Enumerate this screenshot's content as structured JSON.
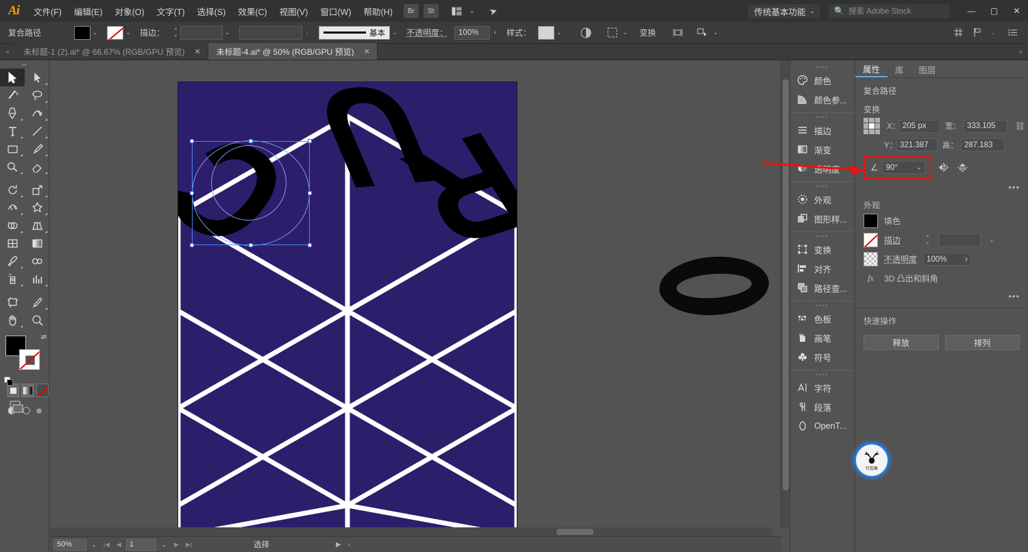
{
  "app": {
    "name": "Adobe Illustrator",
    "logo_text": "Ai"
  },
  "menubar": {
    "items": [
      {
        "label": "文件(F)",
        "name": "menu-file"
      },
      {
        "label": "编辑(E)",
        "name": "menu-edit"
      },
      {
        "label": "对象(O)",
        "name": "menu-object"
      },
      {
        "label": "文字(T)",
        "name": "menu-type"
      },
      {
        "label": "选择(S)",
        "name": "menu-select"
      },
      {
        "label": "效果(C)",
        "name": "menu-effect"
      },
      {
        "label": "视图(V)",
        "name": "menu-view"
      },
      {
        "label": "窗口(W)",
        "name": "menu-window"
      },
      {
        "label": "帮助(H)",
        "name": "menu-help"
      }
    ],
    "bridge_button": "Br",
    "stock_button": "St",
    "arrange_caret": "⌄",
    "workspace": "传统基本功能",
    "workspace_caret": "⌄",
    "search_placeholder": "搜索 Adobe Stock",
    "window_minimize": "—",
    "window_maximize": "▢",
    "window_close": "✕"
  },
  "controlbar": {
    "object_label": "复合路径",
    "fill_swatch_color": "#000000",
    "stroke_swatch": "none",
    "stroke_label": "描边：",
    "stroke_weight_value": "",
    "stroke_profile_value": "",
    "brush_label": "基本",
    "opacity_label": "不透明度：",
    "opacity_value": "100%",
    "style_label": "样式：",
    "transparency_icon": "transparency-icon",
    "select_similar_icon": "select-similar-icon",
    "transform_label": "变换",
    "align_icon": "align-icon",
    "arrange_icon": "arrange-icon",
    "right_icons": [
      "grid-icon",
      "flow-icon",
      "list-icon"
    ]
  },
  "tabs": [
    {
      "title": "未标题-1 (2).ai* @ 66.67% (RGB/GPU 预览)",
      "active": false,
      "close": "✕"
    },
    {
      "title": "未标题-4.ai* @ 50% (RGB/GPU 预览)",
      "active": true,
      "close": "✕"
    }
  ],
  "toolbar": {
    "tools": [
      {
        "name": "selection-tool",
        "selected": true
      },
      {
        "name": "direct-selection-tool",
        "selected": false
      },
      {
        "name": "magic-wand-tool",
        "selected": false
      },
      {
        "name": "lasso-tool",
        "selected": false
      },
      {
        "name": "pen-tool",
        "selected": false
      },
      {
        "name": "curvature-tool",
        "selected": false
      },
      {
        "name": "type-tool",
        "selected": false
      },
      {
        "name": "line-segment-tool",
        "selected": false
      },
      {
        "name": "rectangle-tool",
        "selected": false
      },
      {
        "name": "paintbrush-tool",
        "selected": false
      },
      {
        "name": "shaper-tool",
        "selected": false
      },
      {
        "name": "eraser-tool",
        "selected": false
      },
      {
        "name": "rotate-tool",
        "selected": false
      },
      {
        "name": "scale-tool",
        "selected": false
      },
      {
        "name": "width-tool",
        "selected": false
      },
      {
        "name": "free-transform-tool",
        "selected": false
      },
      {
        "name": "shape-builder-tool",
        "selected": false
      },
      {
        "name": "perspective-grid-tool",
        "selected": false
      },
      {
        "name": "mesh-tool",
        "selected": false
      },
      {
        "name": "gradient-tool",
        "selected": false
      },
      {
        "name": "eyedropper-tool",
        "selected": false
      },
      {
        "name": "blend-tool",
        "selected": false
      },
      {
        "name": "symbol-sprayer-tool",
        "selected": false
      },
      {
        "name": "column-graph-tool",
        "selected": false
      },
      {
        "name": "artboard-tool",
        "selected": false
      },
      {
        "name": "slice-tool",
        "selected": false
      },
      {
        "name": "hand-tool",
        "selected": false
      },
      {
        "name": "zoom-tool",
        "selected": false
      }
    ],
    "fill_color": "#000000",
    "stroke_color": "none",
    "mode_buttons": [
      "color-mode",
      "gradient-mode",
      "none-mode"
    ]
  },
  "canvas": {
    "artboard_background": "#2d1e6b",
    "grid_stroke": "#ffffff",
    "letters": [
      {
        "char": "C",
        "name": "letter-c"
      },
      {
        "char": "U",
        "name": "letter-u"
      },
      {
        "char": "R",
        "name": "letter-r"
      }
    ],
    "loose_object": "letter-o-ellipse",
    "selection": {
      "active": true,
      "target": "letter-c"
    }
  },
  "panel_rail": {
    "groups": [
      {
        "items": [
          {
            "label": "颜色",
            "icon": "palette-icon",
            "name": "panel-color"
          },
          {
            "label": "颜色参...",
            "icon": "color-guide-icon",
            "name": "panel-color-guide"
          }
        ]
      },
      {
        "items": [
          {
            "label": "描边",
            "icon": "stroke-icon",
            "name": "panel-stroke"
          },
          {
            "label": "渐变",
            "icon": "gradient-icon",
            "name": "panel-gradient"
          },
          {
            "label": "透明度",
            "icon": "transparency-icon",
            "name": "panel-transparency"
          }
        ]
      },
      {
        "items": [
          {
            "label": "外观",
            "icon": "appearance-icon",
            "name": "panel-appearance"
          },
          {
            "label": "图形样...",
            "icon": "graphic-styles-icon",
            "name": "panel-graphic-styles"
          }
        ]
      },
      {
        "items": [
          {
            "label": "变换",
            "icon": "transform-icon",
            "name": "panel-transform"
          },
          {
            "label": "对齐",
            "icon": "align-icon",
            "name": "panel-align"
          },
          {
            "label": "路径查...",
            "icon": "pathfinder-icon",
            "name": "panel-pathfinder"
          }
        ]
      },
      {
        "items": [
          {
            "label": "色板",
            "icon": "swatches-icon",
            "name": "panel-swatches"
          },
          {
            "label": "画笔",
            "icon": "brushes-icon",
            "name": "panel-brushes"
          },
          {
            "label": "符号",
            "icon": "symbols-icon",
            "name": "panel-symbols"
          }
        ]
      },
      {
        "items": [
          {
            "label": "字符",
            "icon": "character-icon",
            "name": "panel-character"
          },
          {
            "label": "段落",
            "icon": "paragraph-icon",
            "name": "panel-paragraph"
          },
          {
            "label": "OpenT...",
            "icon": "opentype-icon",
            "name": "panel-opentype"
          }
        ]
      }
    ]
  },
  "properties": {
    "tabs": [
      {
        "label": "属性",
        "active": true
      },
      {
        "label": "库",
        "active": false
      },
      {
        "label": "图层",
        "active": false
      }
    ],
    "object_type": "复合路径",
    "transform": {
      "section_label": "变换",
      "x_label": "X：",
      "x_value": "205 px",
      "y_label": "Y：",
      "y_value": "321.387",
      "w_label": "宽：",
      "w_value": "333.105",
      "h_label": "高：",
      "h_value": "287.183",
      "link_icon": "link-broken-icon",
      "angle_label": "∠:",
      "angle_value": "90°",
      "angle_caret": "⌄",
      "flip_horizontal_icon": "flip-horizontal-icon",
      "flip_vertical_icon": "flip-vertical-icon",
      "more_options": "•••",
      "highlight_color": "#ee1111"
    },
    "appearance": {
      "section_label": "外观",
      "fill_label": "填色",
      "fill_color": "#000000",
      "stroke_label": "描边",
      "stroke_color": "none",
      "stroke_weight_value": "",
      "stroke_caret": "⌄",
      "opacity_label": "不透明度",
      "opacity_value": "100%",
      "opacity_arrow": "›",
      "effect_icon": "fx",
      "effect_label": "3D 凸出和斜角",
      "more_options": "•••"
    },
    "quick_actions": {
      "section_label": "快速操作",
      "buttons": [
        {
          "label": "释放",
          "name": "release-button"
        },
        {
          "label": "排列",
          "name": "arrange-button"
        }
      ]
    }
  },
  "statusbar": {
    "zoom_value": "50%",
    "zoom_caret": "⌄",
    "first_page": "|◀",
    "prev_page": "◀",
    "page_value": "1",
    "page_caret": "⌄",
    "next_page": "▶",
    "last_page": "▶|",
    "status_text": "选择",
    "nav_next": "▶",
    "nav_prev": "‹"
  },
  "badge": {
    "icon": "deer-antler-icon",
    "text": "行志鱼"
  }
}
